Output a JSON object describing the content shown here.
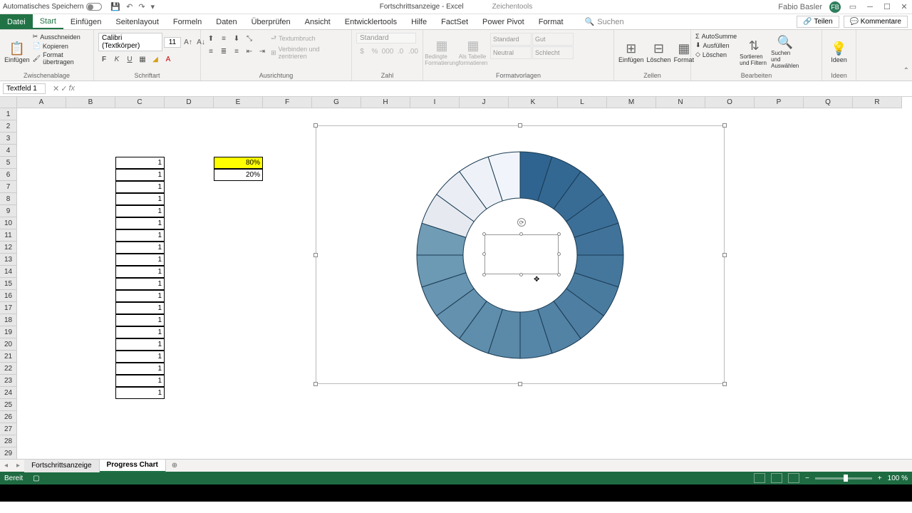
{
  "titlebar": {
    "autosave": "Automatisches Speichern",
    "doc_title": "Fortschrittsanzeige - Excel",
    "tools": "Zeichentools",
    "user": "Fabio Basler",
    "user_initials": "FB"
  },
  "tabs": {
    "file": "Datei",
    "start": "Start",
    "einfuegen": "Einfügen",
    "seitenlayout": "Seitenlayout",
    "formeln": "Formeln",
    "daten": "Daten",
    "ueberpruefen": "Überprüfen",
    "ansicht": "Ansicht",
    "entwickler": "Entwicklertools",
    "hilfe": "Hilfe",
    "factset": "FactSet",
    "powerpivot": "Power Pivot",
    "format": "Format",
    "search": "Suchen",
    "teilen": "Teilen",
    "kommentare": "Kommentare"
  },
  "ribbon": {
    "einfuegen": "Einfügen",
    "ausschneiden": "Ausschneiden",
    "kopieren": "Kopieren",
    "format_uebertragen": "Format übertragen",
    "zwischenablage": "Zwischenablage",
    "font_name": "Calibri (Textkörper)",
    "font_size": "11",
    "schriftart": "Schriftart",
    "textumbruch": "Textumbruch",
    "verbinden": "Verbinden und zentrieren",
    "ausrichtung": "Ausrichtung",
    "standard": "Standard",
    "zahl": "Zahl",
    "bedingte": "Bedingte Formatierung",
    "als_tabelle": "Als Tabelle formatieren",
    "std": "Standard",
    "gut": "Gut",
    "neutral": "Neutral",
    "schlecht": "Schlecht",
    "formatvorlagen": "Formatvorlagen",
    "einf": "Einfügen",
    "loeschen": "Löschen",
    "fmt": "Format",
    "zellen": "Zellen",
    "autosumme": "AutoSumme",
    "ausfuellen": "Ausfüllen",
    "loeschen2": "Löschen",
    "sortieren": "Sortieren und Filtern",
    "suchen": "Suchen und Auswählen",
    "bearbeiten": "Bearbeiten",
    "ideen": "Ideen"
  },
  "namebox": "Textfeld 1",
  "columns": [
    "A",
    "B",
    "C",
    "D",
    "E",
    "F",
    "G",
    "H",
    "I",
    "J",
    "K",
    "L",
    "M",
    "N",
    "O",
    "P",
    "Q",
    "R"
  ],
  "rows": [
    "1",
    "2",
    "3",
    "4",
    "5",
    "6",
    "7",
    "8",
    "9",
    "10",
    "11",
    "12",
    "13",
    "14",
    "15",
    "16",
    "17",
    "18",
    "19",
    "20",
    "21",
    "22",
    "23",
    "24",
    "25",
    "26",
    "27",
    "28",
    "29"
  ],
  "data_c": [
    "1",
    "1",
    "1",
    "1",
    "1",
    "1",
    "1",
    "1",
    "1",
    "1",
    "1",
    "1",
    "1",
    "1",
    "1",
    "1",
    "1",
    "1",
    "1",
    "1"
  ],
  "cell_e5": "80%",
  "cell_e6": "20%",
  "sheets": {
    "s1": "Fortschrittsanzeige",
    "s2": "Progress Chart"
  },
  "status": {
    "ready": "Bereit",
    "zoom": "100 %"
  },
  "chart_data": {
    "type": "donut",
    "segments": 20,
    "progress_pct": 80,
    "remaining_pct": 20,
    "colors_dark": "#2f6490",
    "colors_light": "#e8eef5"
  }
}
